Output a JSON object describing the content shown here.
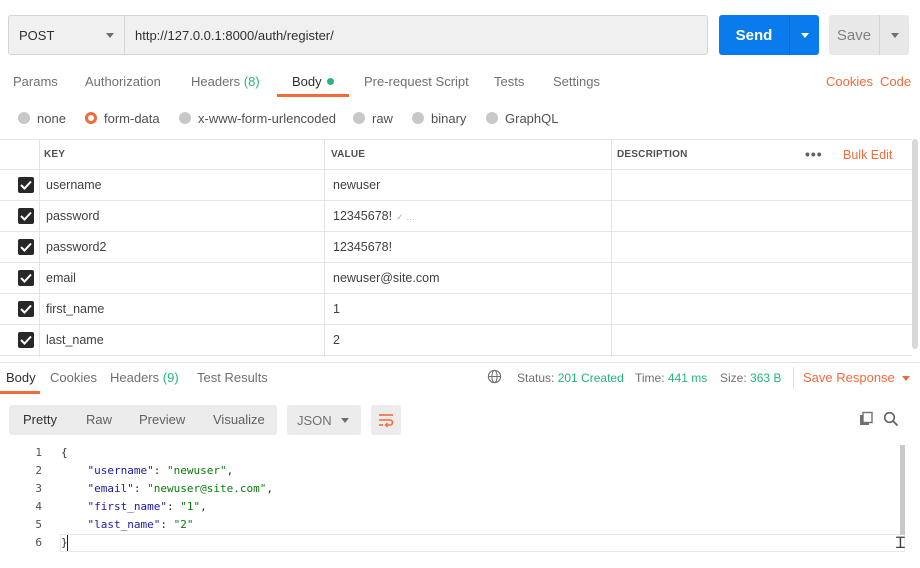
{
  "request": {
    "method": "POST",
    "url": "http://127.0.0.1:8000/auth/register/",
    "send_label": "Send",
    "save_label": "Save"
  },
  "request_tabs": [
    {
      "label": "Params"
    },
    {
      "label": "Authorization"
    },
    {
      "label": "Headers",
      "count": "(8)"
    },
    {
      "label": "Body",
      "active": true
    },
    {
      "label": "Pre-request Script"
    },
    {
      "label": "Tests"
    },
    {
      "label": "Settings"
    }
  ],
  "links": {
    "cookies": "Cookies",
    "code": "Code"
  },
  "body_types": [
    {
      "label": "none"
    },
    {
      "label": "form-data",
      "selected": true
    },
    {
      "label": "x-www-form-urlencoded"
    },
    {
      "label": "raw"
    },
    {
      "label": "binary"
    },
    {
      "label": "GraphQL"
    }
  ],
  "params_table": {
    "columns": [
      "KEY",
      "VALUE",
      "DESCRIPTION"
    ],
    "more_label": "•••",
    "bulk_edit": "Bulk Edit",
    "rows": [
      {
        "key": "username",
        "value": "newuser",
        "checked": true
      },
      {
        "key": "password",
        "value": "12345678!",
        "checked": true,
        "icon": "✓ …"
      },
      {
        "key": "password2",
        "value": "12345678!",
        "checked": true
      },
      {
        "key": "email",
        "value": "newuser@site.com",
        "checked": true
      },
      {
        "key": "first_name",
        "value": "1",
        "checked": true
      },
      {
        "key": "last_name",
        "value": "2",
        "checked": true
      }
    ]
  },
  "response_tabs": [
    {
      "label": "Body",
      "active": true
    },
    {
      "label": "Cookies"
    },
    {
      "label": "Headers",
      "count": "(9)"
    },
    {
      "label": "Test Results"
    }
  ],
  "response_meta": {
    "status_label": "Status:",
    "status_value": "201 Created",
    "time_label": "Time:",
    "time_value": "441 ms",
    "size_label": "Size:",
    "size_value": "363 B",
    "save_response": "Save Response"
  },
  "view_modes": [
    {
      "label": "Pretty",
      "active": true
    },
    {
      "label": "Raw"
    },
    {
      "label": "Preview"
    },
    {
      "label": "Visualize"
    }
  ],
  "format": "JSON",
  "response_code": [
    {
      "n": "1",
      "text": "{"
    },
    {
      "n": "2",
      "key": "\"username\"",
      "value": "\"newuser\"",
      "comma": true
    },
    {
      "n": "3",
      "key": "\"email\"",
      "value": "\"newuser@site.com\"",
      "comma": true
    },
    {
      "n": "4",
      "key": "\"first_name\"",
      "value": "\"1\"",
      "comma": true
    },
    {
      "n": "5",
      "key": "\"last_name\"",
      "value": "\"2\"",
      "comma": false
    },
    {
      "n": "6",
      "text": "}"
    }
  ],
  "colors": {
    "accent": "#f26b3a",
    "send": "#097bed",
    "success": "#26b47f"
  },
  "icons": [
    "caret-down-icon",
    "check-icon",
    "globe-icon",
    "wrap-lines-icon",
    "copy-icon",
    "search-icon"
  ]
}
